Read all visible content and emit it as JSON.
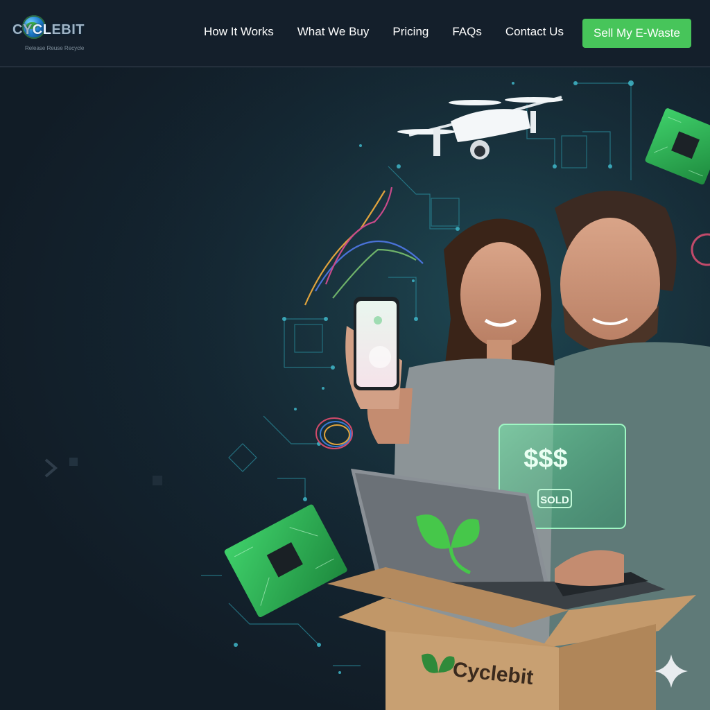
{
  "brand": {
    "logo_text_prefix": "CY",
    "logo_text_highlight": "CL",
    "logo_text_suffix": "EBIT",
    "tagline": "Release Reuse Recycle"
  },
  "nav": {
    "items": [
      {
        "label": "How It Works"
      },
      {
        "label": "What We Buy"
      },
      {
        "label": "Pricing"
      },
      {
        "label": "FAQs"
      },
      {
        "label": "Contact Us"
      }
    ],
    "cta_label": "Sell My E-Waste"
  },
  "hero": {
    "card_amount": "$$$",
    "card_status": "SOLD",
    "box_brand": "Cyclebit"
  },
  "colors": {
    "accent": "#47c55a",
    "background": "#121d27",
    "header": "#141f2b",
    "circuit_line": "#2a8a9a"
  },
  "icons": [
    "globe-logo-icon",
    "sparkle-icon",
    "leaf-icon"
  ]
}
